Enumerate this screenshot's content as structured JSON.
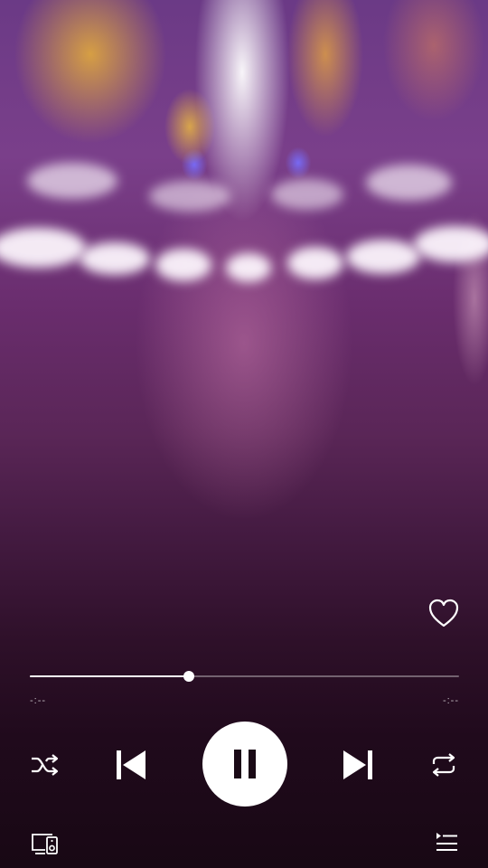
{
  "player": {
    "elapsed_time": "-:--",
    "remaining_time": "-:--",
    "progress_fraction": 0.37,
    "is_playing": true
  },
  "icons": {
    "like": "heart-outline-icon",
    "shuffle": "shuffle-icon",
    "previous": "skip-previous-icon",
    "play_pause": "pause-icon",
    "next": "skip-next-icon",
    "repeat": "repeat-icon",
    "devices": "connect-devices-icon",
    "queue": "queue-icon"
  },
  "colors": {
    "accent": "#ffffff",
    "track": "rgba(255,255,255,0.35)"
  }
}
